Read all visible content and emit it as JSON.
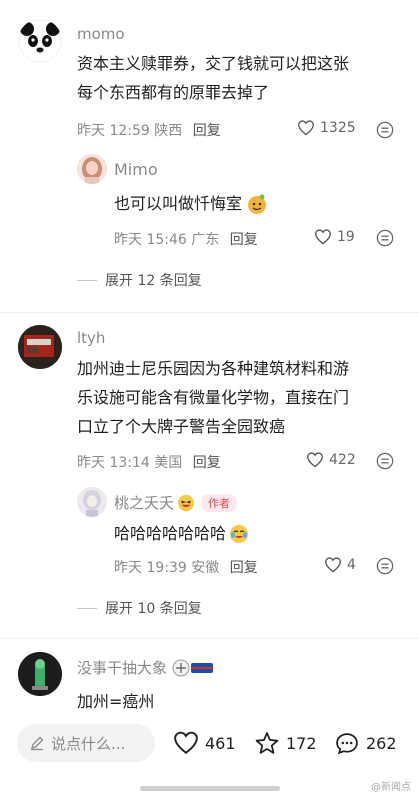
{
  "comments": [
    {
      "name": "momo",
      "lines": [
        "资本主义赎罪券，交了钱就可以把这张",
        "每个东西都有的原罪去掉了"
      ],
      "meta": "昨天 12:59 陕西",
      "reply": "回复",
      "likes": "1325"
    },
    {
      "name": "Mimo",
      "lines": [
        "也可以叫做忏悔室"
      ],
      "meta": "昨天 15:46 广东",
      "reply": "回复",
      "likes": "19"
    },
    {
      "name": "ltyh",
      "lines": [
        "加州迪士尼乐园因为各种建筑材料和游",
        "乐设施可能含有微量化学物，直接在门",
        "口立了个大牌子警告全园致癌"
      ],
      "meta": "昨天 13:14 美国",
      "reply": "回复",
      "likes": "422"
    },
    {
      "name": "桃之夭夭",
      "author_tag": "作者",
      "lines": [
        "哈哈哈哈哈哈哈"
      ],
      "meta": "昨天 19:39 安徽",
      "reply": "回复",
      "likes": "4"
    },
    {
      "name": "没事干抽大象",
      "lines": [
        "加州=癌州"
      ]
    }
  ],
  "expand_1": "展开 12 条回复",
  "expand_2": "展开 10 条回复",
  "bottom": {
    "input_placeholder": "说点什么...",
    "likes": "461",
    "favorites": "172",
    "comments": "262"
  },
  "watermark": "@新闻点",
  "icons": {
    "like": "heart-icon",
    "more": "more-options-icon",
    "pencil": "pencil-icon",
    "star": "star-icon",
    "comment": "comment-bubble-icon"
  }
}
